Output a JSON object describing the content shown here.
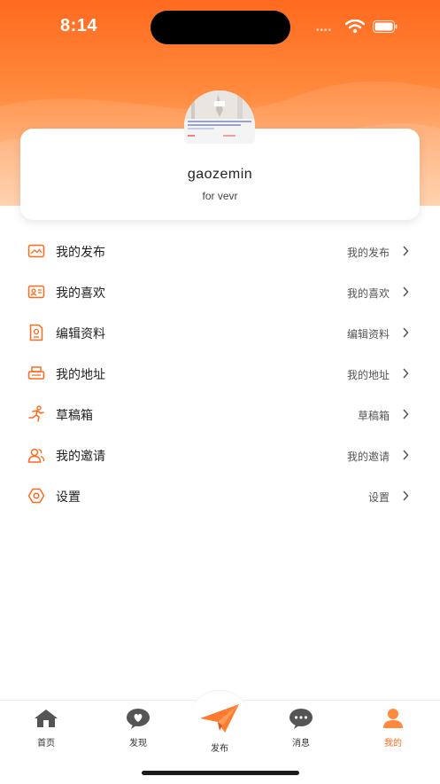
{
  "status_bar": {
    "time": "8:14"
  },
  "profile": {
    "username": "gaozemin",
    "bio": "for vevr",
    "avatar_icon": "profile-photo"
  },
  "menu": [
    {
      "label": "我的发布",
      "value": "我的发布",
      "icon": "image-frame-icon"
    },
    {
      "label": "我的喜欢",
      "value": "我的喜欢",
      "icon": "id-card-icon"
    },
    {
      "label": "编辑资料",
      "value": "编辑资料",
      "icon": "edit-document-icon"
    },
    {
      "label": "我的地址",
      "value": "我的地址",
      "icon": "printer-icon"
    },
    {
      "label": "草稿箱",
      "value": "草稿箱",
      "icon": "running-person-icon"
    },
    {
      "label": "我的邀请",
      "value": "我的邀请",
      "icon": "users-icon"
    },
    {
      "label": "设置",
      "value": "设置",
      "icon": "settings-gear-icon"
    }
  ],
  "tabbar": [
    {
      "label": "首页",
      "icon": "home-icon",
      "active": false
    },
    {
      "label": "发现",
      "icon": "heart-bubble-icon",
      "active": false
    },
    {
      "label": "发布",
      "icon": "paper-plane-icon",
      "active": false
    },
    {
      "label": "消息",
      "icon": "chat-bubble-icon",
      "active": false
    },
    {
      "label": "我的",
      "icon": "person-icon",
      "active": true
    }
  ],
  "colors": {
    "accent": "#ff6a1f",
    "icon_gray": "#555555"
  }
}
